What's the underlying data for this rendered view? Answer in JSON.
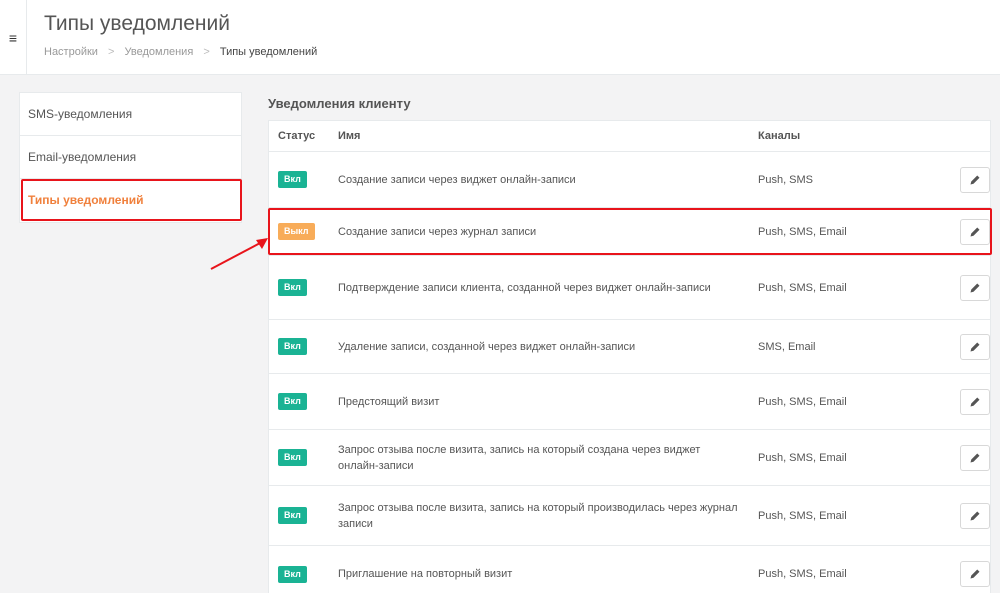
{
  "header": {
    "menu_glyph": "≡",
    "title": "Типы уведомлений",
    "breadcrumb": [
      "Настройки",
      "Уведомления",
      "Типы уведомлений"
    ],
    "breadcrumb_sep": ">"
  },
  "sidebar": {
    "items": [
      {
        "label": "SMS-уведомления",
        "active": false
      },
      {
        "label": "Email-уведомления",
        "active": false
      },
      {
        "label": "Типы уведомлений",
        "active": true
      }
    ]
  },
  "section": {
    "title": "Уведомления клиенту"
  },
  "table": {
    "headers": {
      "status": "Статус",
      "name": "Имя",
      "channels": "Каналы"
    },
    "rows": [
      {
        "status": "Вкл",
        "enabled": true,
        "name": "Создание записи через виджет онлайн-записи",
        "channels": "Push, SMS"
      },
      {
        "status": "Выкл",
        "enabled": false,
        "name": "Создание записи через журнал записи",
        "channels": "Push, SMS, Email"
      },
      {
        "status": "Вкл",
        "enabled": true,
        "name": "Подтверждение записи клиента, созданной через виджет онлайн-записи",
        "channels": "Push, SMS, Email"
      },
      {
        "status": "Вкл",
        "enabled": true,
        "name": "Удаление записи, созданной через виджет онлайн-записи",
        "channels": "SMS, Email"
      },
      {
        "status": "Вкл",
        "enabled": true,
        "name": "Предстоящий визит",
        "channels": "Push, SMS, Email"
      },
      {
        "status": "Вкл",
        "enabled": true,
        "name": "Запрос отзыва после визита, запись на который создана через виджет онлайн-записи",
        "channels": "Push, SMS, Email"
      },
      {
        "status": "Вкл",
        "enabled": true,
        "name": "Запрос отзыва после визита, запись на который производилась через журнал записи",
        "channels": "Push, SMS, Email"
      },
      {
        "status": "Вкл",
        "enabled": true,
        "name": "Приглашение на повторный визит",
        "channels": "Push, SMS, Email"
      }
    ]
  },
  "colors": {
    "badge_on": "#1ab394",
    "badge_off": "#f8ac59",
    "active_link": "#f0803c",
    "highlight": "#e8141b"
  },
  "icons": {
    "menu": "hamburger-icon",
    "edit": "pencil-icon"
  }
}
